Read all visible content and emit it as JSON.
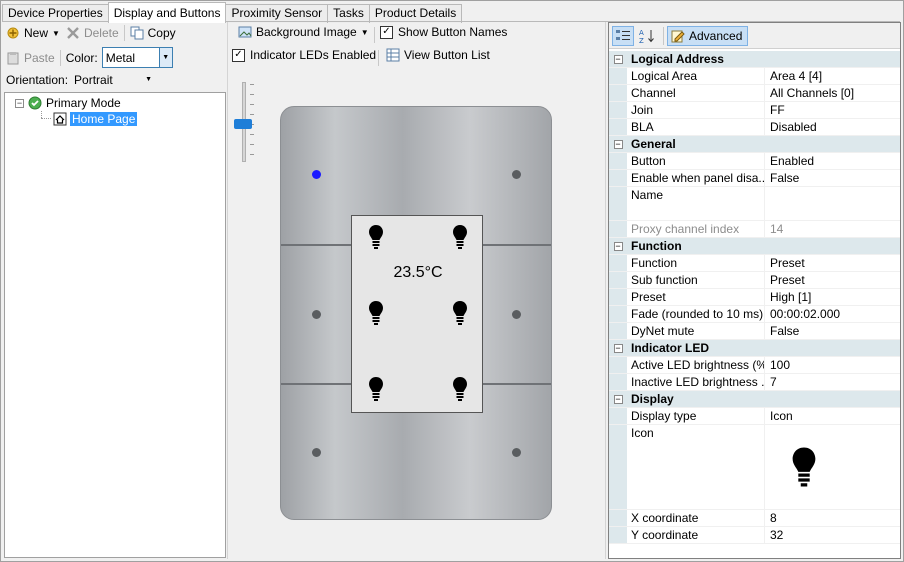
{
  "tabs": [
    {
      "label": "Device Properties",
      "active": false
    },
    {
      "label": "Display and Buttons",
      "active": true
    },
    {
      "label": "Proximity Sensor",
      "active": false
    },
    {
      "label": "Tasks",
      "active": false
    },
    {
      "label": "Product Details",
      "active": false
    }
  ],
  "left_toolbar": {
    "new_label": "New",
    "delete_label": "Delete",
    "copy_label": "Copy",
    "paste_label": "Paste",
    "color_label": "Color:",
    "color_value": "Metal",
    "orientation_label": "Orientation:",
    "orientation_value": "Portrait"
  },
  "tree": {
    "root_label": "Primary Mode",
    "child_label": "Home Page"
  },
  "center_toolbar": {
    "background_image_label": "Background Image",
    "show_button_names_label": "Show Button Names",
    "show_button_names_checked": true,
    "indicator_leds_label": "Indicator LEDs Enabled",
    "indicator_leds_checked": true,
    "view_button_list_label": "View Button List"
  },
  "preview": {
    "temperature": "23.5°C",
    "panel_color": "#b4b7ba",
    "active_led_color": "#1a1aff"
  },
  "property_grid": {
    "advanced_label": "Advanced",
    "categories": [
      {
        "title": "Logical Address",
        "rows": [
          {
            "key": "Logical Area",
            "value": "Area 4 [4]"
          },
          {
            "key": "Channel",
            "value": "All Channels [0]"
          },
          {
            "key": "Join",
            "value": "FF"
          },
          {
            "key": "BLA",
            "value": "Disabled"
          }
        ]
      },
      {
        "title": "General",
        "rows": [
          {
            "key": "Button",
            "value": "Enabled"
          },
          {
            "key": "Enable when panel disa...",
            "value": "False"
          },
          {
            "key": "Name",
            "value": ""
          },
          {
            "key": "Proxy channel index",
            "value": "14"
          }
        ]
      },
      {
        "title": "Function",
        "rows": [
          {
            "key": "Function",
            "value": "Preset"
          },
          {
            "key": "Sub function",
            "value": "Preset"
          },
          {
            "key": "Preset",
            "value": "High [1]"
          },
          {
            "key": "Fade (rounded to 10 ms)",
            "value": "00:00:02.000"
          },
          {
            "key": "DyNet mute",
            "value": "False"
          }
        ]
      },
      {
        "title": "Indicator LED",
        "rows": [
          {
            "key": "Active LED brightness (%)",
            "value": "100"
          },
          {
            "key": "Inactive LED brightness ...",
            "value": "7"
          }
        ]
      },
      {
        "title": "Display",
        "rows": [
          {
            "key": "Display type",
            "value": "Icon"
          },
          {
            "key": "Icon",
            "value": ""
          },
          {
            "key": "X coordinate",
            "value": "8"
          },
          {
            "key": "Y coordinate",
            "value": "32"
          }
        ]
      }
    ]
  }
}
